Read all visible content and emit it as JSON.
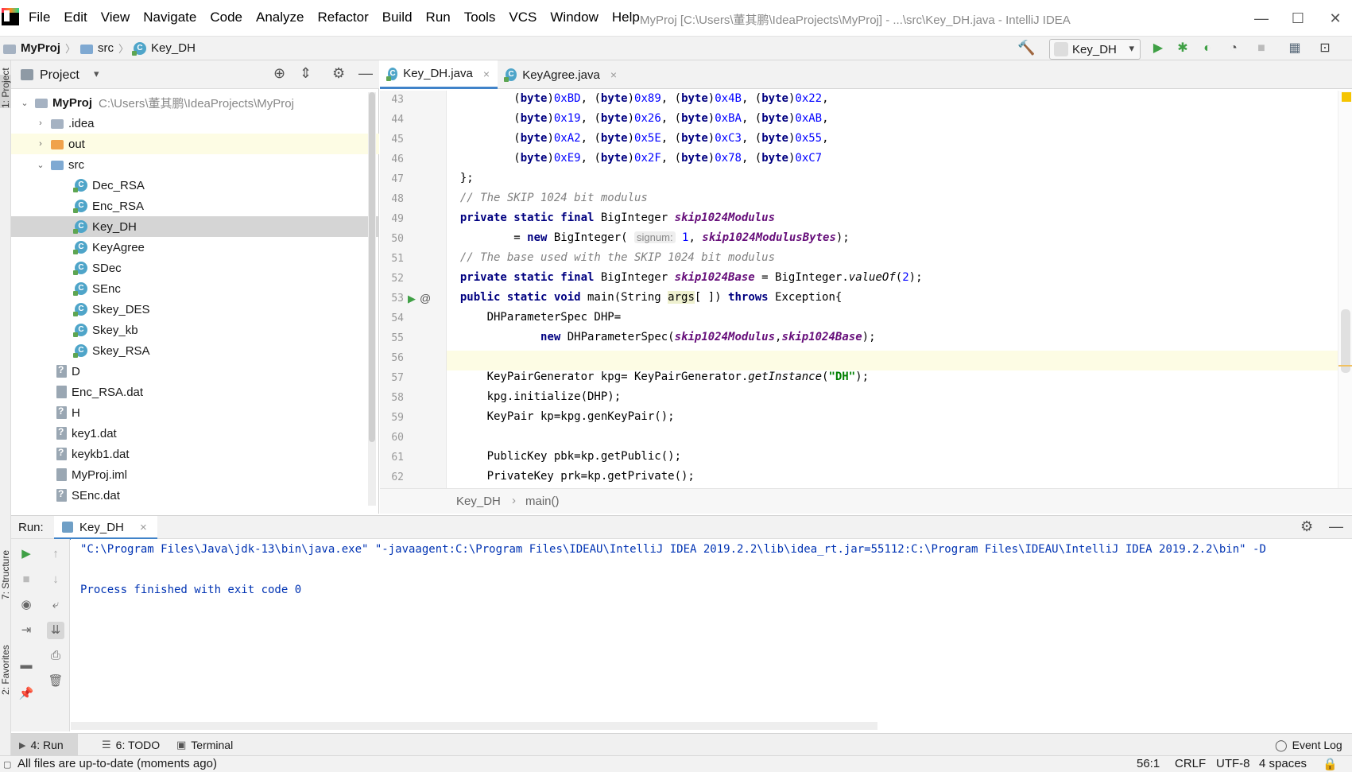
{
  "menu": [
    "File",
    "Edit",
    "View",
    "Navigate",
    "Code",
    "Analyze",
    "Refactor",
    "Build",
    "Run",
    "Tools",
    "VCS",
    "Window",
    "Help"
  ],
  "window_title": "MyProj [C:\\Users\\董其鹏\\IdeaProjects\\MyProj] - ...\\src\\Key_DH.java - IntelliJ IDEA",
  "navbar": {
    "crumbs": [
      "MyProj",
      "src",
      "Key_DH"
    ],
    "run_config": "Key_DH"
  },
  "left_stripe": {
    "project": "1: Project",
    "structure": "7: Structure",
    "favorites": "2: Favorites"
  },
  "project_panel": {
    "title": "Project",
    "tree": [
      {
        "label": "MyProj",
        "hint": "C:\\Users\\董其鹏\\IdeaProjects\\MyProj"
      },
      {
        "label": ".idea"
      },
      {
        "label": "out"
      },
      {
        "label": "src"
      },
      {
        "label": "Dec_RSA"
      },
      {
        "label": "Enc_RSA"
      },
      {
        "label": "Key_DH"
      },
      {
        "label": "KeyAgree"
      },
      {
        "label": "SDec"
      },
      {
        "label": "SEnc"
      },
      {
        "label": "Skey_DES"
      },
      {
        "label": "Skey_kb"
      },
      {
        "label": "Skey_RSA"
      },
      {
        "label": "D"
      },
      {
        "label": "Enc_RSA.dat"
      },
      {
        "label": "H"
      },
      {
        "label": "key1.dat"
      },
      {
        "label": "keykb1.dat"
      },
      {
        "label": "MyProj.iml"
      },
      {
        "label": "SEnc.dat"
      }
    ]
  },
  "editor": {
    "tabs": [
      "Key_DH.java",
      "KeyAgree.java"
    ],
    "line_numbers": [
      "43",
      "44",
      "45",
      "46",
      "47",
      "48",
      "49",
      "50",
      "51",
      "52",
      "53",
      "54",
      "55",
      "56",
      "57",
      "58",
      "59",
      "60",
      "61",
      "62"
    ],
    "hint_signum": "signum:",
    "breadcrumb": [
      "Key_DH",
      "main()"
    ]
  },
  "run_panel": {
    "label": "Run:",
    "tab": "Key_DH",
    "console": [
      "\"C:\\Program Files\\Java\\jdk-13\\bin\\java.exe\" \"-javaagent:C:\\Program Files\\IDEAU\\IntelliJ IDEA 2019.2.2\\lib\\idea_rt.jar=55112:C:\\Program Files\\IDEAU\\IntelliJ IDEA 2019.2.2\\bin\" -D",
      "Process finished with exit code 0"
    ]
  },
  "bottom_tabs": {
    "run": "4: Run",
    "todo": "6: TODO",
    "terminal": "Terminal",
    "event_log": "Event Log"
  },
  "status": {
    "message": "All files are up-to-date (moments ago)",
    "position": "56:1",
    "line_sep": "CRLF",
    "encoding": "UTF-8",
    "indent": "4 spaces"
  },
  "colors": {
    "accent": "#4083c9",
    "keyword": "#000080",
    "field": "#660e7a",
    "string": "#008000",
    "number": "#0000ff",
    "run_green": "#3fa045"
  }
}
